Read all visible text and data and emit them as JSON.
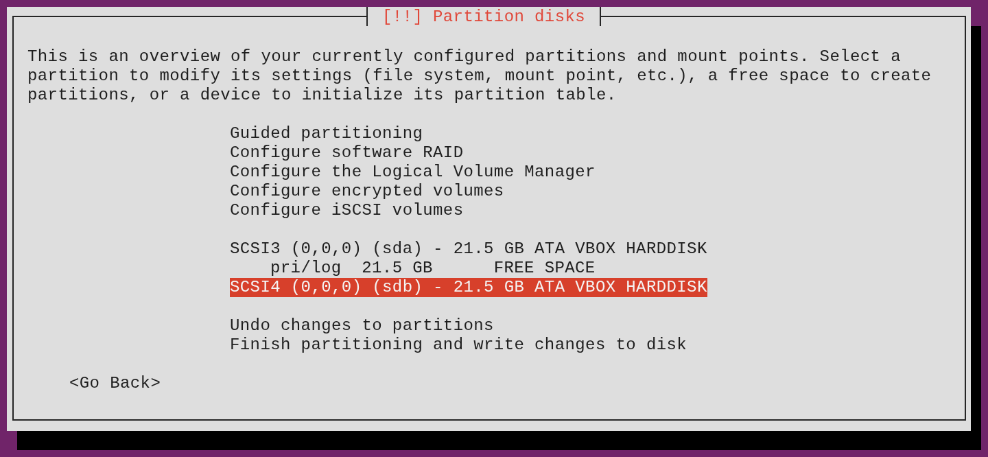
{
  "dialog": {
    "title": "[!!] Partition disks",
    "description": "This is an overview of your currently configured partitions and mount points. Select a partition to modify its settings (file system, mount point, etc.), a free space to create partitions, or a device to initialize its partition table."
  },
  "menu": [
    {
      "items": [
        {
          "label": "Guided partitioning",
          "selected": false
        },
        {
          "label": "Configure software RAID",
          "selected": false
        },
        {
          "label": "Configure the Logical Volume Manager",
          "selected": false
        },
        {
          "label": "Configure encrypted volumes",
          "selected": false
        },
        {
          "label": "Configure iSCSI volumes",
          "selected": false
        }
      ]
    },
    {
      "items": [
        {
          "label": "SCSI3 (0,0,0) (sda) - 21.5 GB ATA VBOX HARDDISK",
          "selected": false,
          "children": [
            {
              "label": "pri/log  21.5 GB      FREE SPACE",
              "selected": false
            }
          ]
        },
        {
          "label": "SCSI4 (0,0,0) (sdb) - 21.5 GB ATA VBOX HARDDISK",
          "selected": true
        }
      ]
    },
    {
      "items": [
        {
          "label": "Undo changes to partitions",
          "selected": false
        },
        {
          "label": "Finish partitioning and write changes to disk",
          "selected": false
        }
      ]
    }
  ],
  "back_button": {
    "label": "<Go Back>"
  }
}
